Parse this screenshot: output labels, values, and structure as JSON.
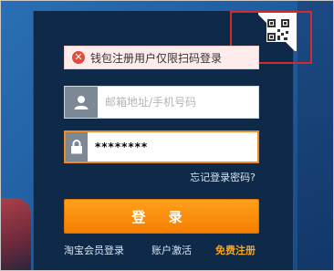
{
  "alert": {
    "icon": "x-circle-icon",
    "text": "钱包注册用户仅限扫码登录"
  },
  "form": {
    "username": {
      "placeholder": "邮箱地址/手机号码",
      "value": "",
      "icon": "user-icon"
    },
    "password": {
      "value": "********",
      "icon": "lock-icon"
    }
  },
  "links": {
    "forgot": "忘记登录密码?"
  },
  "login_button": {
    "label": "登 录"
  },
  "footer": {
    "member_login": "淘宝会员登录",
    "activate": "账户激活",
    "register": "免费注册"
  },
  "colors": {
    "accent": "#f57e00",
    "highlight_box": "#d22b2b",
    "panel": "#0e2a48",
    "register_link": "#f7a31c"
  }
}
